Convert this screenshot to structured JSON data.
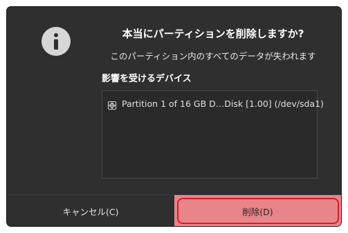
{
  "dialog": {
    "icon": "info-icon",
    "title": "本当にパーティションを削除しますか?",
    "message": "このパーティション内のすべてのデータが失われます",
    "devices_heading": "影響を受けるデバイス",
    "devices": [
      {
        "icon": "drive-icon",
        "label": "Partition 1 of 16 GB D…Disk [1.00] (/dev/sda1)"
      }
    ]
  },
  "buttons": {
    "cancel_label": "キャンセル(C)",
    "delete_label": "削除(D)"
  },
  "colors": {
    "dialog_background": "#2f2f2f",
    "destructive_button": "#e8858a",
    "focus_ring": "#d81a28",
    "text": "#ffffff"
  }
}
